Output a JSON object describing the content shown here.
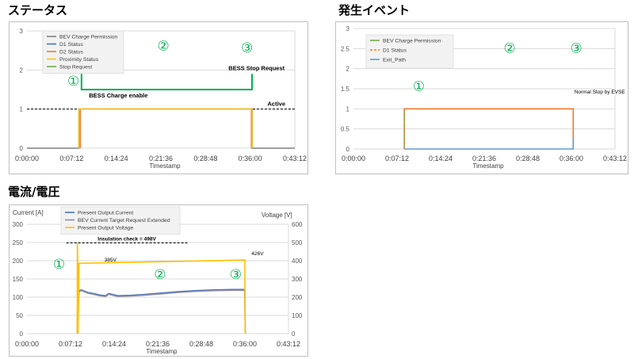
{
  "sections": {
    "status": "ステータス",
    "events": "発生イベント",
    "electrical": "電流/電圧"
  },
  "chart_data": [
    {
      "id": "status",
      "type": "line",
      "xlabel": "Timestamp",
      "ylabel": "",
      "x_tick_labels": [
        "0:00:00",
        "0:07:12",
        "0:14:24",
        "0:21:36",
        "0:28:48",
        "0:36:00",
        "0:43:12"
      ],
      "xlim_minutes": [
        0,
        43.2
      ],
      "ylim": [
        0,
        3
      ],
      "y_ticks": [
        0,
        1,
        2,
        3
      ],
      "grid": "horizontal",
      "legend_position": "top-left",
      "legend": [
        "BEV Charge Permission",
        "D1 Status",
        "D2 Status",
        "Proximity Status",
        "Stop Request"
      ],
      "series": [
        {
          "name": "BEV Charge Permission",
          "color": "#7f7f7f",
          "x": [
            0,
            8.4,
            8.4,
            36.3,
            36.3,
            43.2
          ],
          "y": [
            0,
            0,
            1,
            1,
            0,
            0
          ]
        },
        {
          "name": "D1 Status",
          "color": "#4472c4",
          "x": [
            8.4,
            8.4,
            36.3,
            36.3
          ],
          "y": [
            0,
            1,
            1,
            0
          ]
        },
        {
          "name": "D2 Status",
          "color": "#ed7d31",
          "x": [
            8.6,
            8.6,
            36.2,
            36.2
          ],
          "y": [
            0,
            1,
            1,
            0
          ]
        },
        {
          "name": "Proximity Status",
          "color": "#ffc000",
          "x": [
            8.4,
            8.4,
            36.3,
            36.3
          ],
          "y": [
            0,
            1,
            1,
            0
          ]
        },
        {
          "name": "Stop Request",
          "color": "#70ad47",
          "x": [],
          "y": []
        }
      ],
      "reference_line": {
        "y": 1,
        "label": "Active",
        "color": "#000000"
      },
      "bracket": {
        "x_start": 8.8,
        "x_end": 36.3,
        "y_top": 1.9,
        "y_bottom": 1.5,
        "color": "#00b050"
      },
      "annotations": [
        {
          "text": "BESS Charge enable",
          "x": 10,
          "y": 1.3,
          "bold": true
        },
        {
          "text": "BESS Stop Request",
          "x": 32.5,
          "y": 2.0,
          "bold": true
        }
      ],
      "markers": [
        {
          "text": "①",
          "x": 7.5,
          "y": 1.6
        },
        {
          "text": "②",
          "x": 22,
          "y": 2.5
        },
        {
          "text": "③",
          "x": 35.5,
          "y": 2.45
        }
      ]
    },
    {
      "id": "events",
      "type": "line",
      "xlabel": "Timestamp",
      "ylabel": "",
      "x_tick_labels": [
        "0:00:00",
        "0:07:12",
        "0:14:24",
        "0:21:36",
        "0:28:48",
        "0:36:00",
        "0:43:12"
      ],
      "xlim_minutes": [
        0,
        43.2
      ],
      "ylim": [
        0,
        3
      ],
      "y_ticks": [
        0,
        0.5,
        1,
        1.5,
        2,
        2.5,
        3
      ],
      "y_tick_labels": [
        "0",
        "0.5",
        "1",
        "1.5",
        "2",
        "2.5",
        "3"
      ],
      "grid": "horizontal",
      "legend_position": "top-left",
      "legend": [
        "BEV Charge Permission",
        "D1 Status",
        "Exit_Path"
      ],
      "series": [
        {
          "name": "BEV Charge Permission",
          "color": "#70ad47",
          "x": [
            8.4,
            8.4,
            36.3,
            36.3
          ],
          "y": [
            0,
            1,
            1,
            0
          ]
        },
        {
          "name": "D1 Status",
          "color": "#ed7d31",
          "dashed": true,
          "x": [
            8.4,
            8.4
          ],
          "y": [
            0,
            1
          ]
        },
        {
          "name": "D1 Status",
          "color": "#ed7d31",
          "x": [
            8.4,
            36.3,
            36.3
          ],
          "y": [
            1,
            1,
            0.25
          ]
        },
        {
          "name": "Exit_Path",
          "color": "#5b9bd5",
          "x": [
            8.4,
            36.3,
            36.3,
            36.4
          ],
          "y": [
            0,
            0,
            0.25,
            0.25
          ]
        }
      ],
      "annotations": [
        {
          "text": "Normal Stop by EVSE",
          "x": 36.5,
          "y": 1.38,
          "bold": false
        }
      ],
      "markers": [
        {
          "text": "①",
          "x": 10.8,
          "y": 1.45
        },
        {
          "text": "②",
          "x": 25.8,
          "y": 2.4
        },
        {
          "text": "③",
          "x": 36.8,
          "y": 2.4
        }
      ]
    },
    {
      "id": "electrical",
      "type": "line",
      "xlabel": "Timestamp",
      "ylabel": "Current [A]",
      "ylabel_right": "Voltage [V]",
      "x_tick_labels": [
        "0:00:00",
        "0:07:12",
        "0:14:24",
        "0:21:36",
        "0:28:48",
        "0:36:00",
        "0:43:12"
      ],
      "xlim_minutes": [
        0,
        43.2
      ],
      "ylim": [
        0,
        300
      ],
      "ylim_right": [
        0,
        600
      ],
      "y_ticks": [
        0,
        50,
        100,
        150,
        200,
        250,
        300
      ],
      "y_ticks_right": [
        0,
        100,
        200,
        300,
        400,
        500,
        600
      ],
      "grid": "horizontal",
      "legend_position": "top-left",
      "legend": [
        "Present Output Current",
        "BEV Current Target Request Extended",
        "Present Output Voltage"
      ],
      "series": [
        {
          "name": "Present Output Current",
          "color": "#4472c4",
          "axis": "left",
          "x": [
            8.3,
            8.4,
            8.5,
            8.6,
            9.0,
            10,
            11,
            12,
            13,
            13.5,
            14,
            15,
            17,
            19,
            22,
            25,
            28,
            31,
            34,
            35.8,
            36.0,
            36.05
          ],
          "y": [
            0,
            126,
            88,
            118,
            120,
            113,
            110,
            106,
            104,
            110,
            108,
            104,
            105,
            107,
            111,
            115,
            118,
            120,
            121,
            121,
            118,
            0
          ]
        },
        {
          "name": "BEV Current Target Request Extended",
          "color": "#8c8ca0",
          "axis": "left",
          "x": [
            8.3,
            8.4,
            8.5,
            8.6,
            9.0,
            10,
            11,
            12,
            13,
            13.5,
            14,
            15,
            17,
            19,
            22,
            25,
            28,
            31,
            34,
            35.8,
            36.0,
            36.05
          ],
          "y": [
            0,
            124,
            85,
            116,
            118,
            111,
            108,
            104,
            102,
            108,
            106,
            102,
            103,
            105,
            109,
            113,
            116,
            118,
            119,
            119,
            116,
            0
          ]
        },
        {
          "name": "Present Output Voltage",
          "color": "#ffc000",
          "axis": "right",
          "x": [
            8.3,
            8.32,
            8.4,
            8.45,
            8.6,
            9,
            36.0,
            36.0,
            36.05
          ],
          "y": [
            0,
            498,
            385,
            0,
            385,
            386,
            404,
            300,
            0
          ]
        }
      ],
      "reference_line": {
        "y_right": 498,
        "label": "Insulation check = 498V",
        "color": "#000000",
        "x_start": 6.5,
        "x_end": 26.5
      },
      "annotations": [
        {
          "text": "385V",
          "x": 12.8,
          "y_right": 395,
          "bold": false
        },
        {
          "text": "426V",
          "x": 37.1,
          "y_right": 430,
          "bold": false
        }
      ],
      "markers": [
        {
          "text": "①",
          "x": 5.3,
          "y": 178
        },
        {
          "text": "②",
          "x": 22,
          "y": 150
        },
        {
          "text": "③",
          "x": 34.5,
          "y": 150
        }
      ]
    }
  ]
}
